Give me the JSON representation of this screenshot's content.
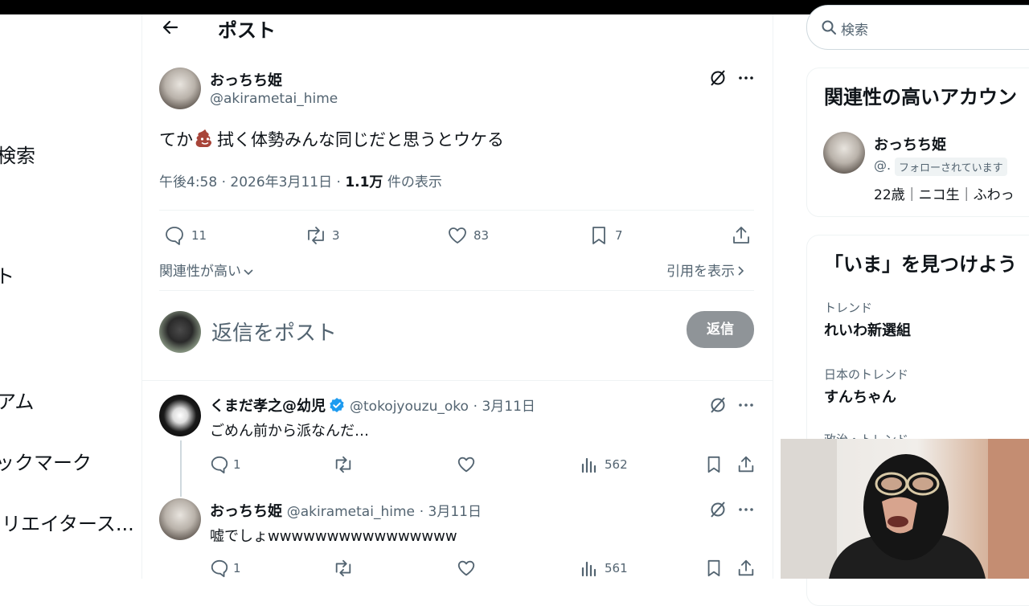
{
  "nav": {
    "items": [
      "検索",
      "ト",
      "アム",
      "ブックマーク",
      "クリエイタース..."
    ]
  },
  "header": {
    "title": "ポスト"
  },
  "post": {
    "author_name": "おっちち姫",
    "author_handle": "@akirametai_hime",
    "text_before": "てか",
    "text_after": "拭く体勢みんな同じだと思うとウケる",
    "meta_time": "午後4:58 · 2026年3月11日 · ",
    "views_count": "1.1万",
    "views_label": " 件の表示",
    "replies": "11",
    "reposts": "3",
    "likes": "83",
    "bookmarks": "7",
    "sort_label": "関連性が高い",
    "quotes_label": "引用を表示"
  },
  "composer": {
    "placeholder": "返信をポスト",
    "button": "返信"
  },
  "replies": [
    {
      "name": "くまだ孝之@幼児",
      "handle": "@tokojyouzu_oko",
      "date": "· 3月11日",
      "text": "ごめん前から派なんだ…",
      "reply_count": "1",
      "views": "562"
    },
    {
      "name": "おっちち姫",
      "handle": "@akirametai_hime",
      "date": "· 3月11日",
      "text": "嘘でしょwwwwwwwwwwwwwwww",
      "reply_count": "1",
      "views": "561"
    }
  ],
  "search": {
    "placeholder": "検索"
  },
  "related": {
    "title": "関連性の高いアカウン",
    "name": "おっちち姫",
    "handle": "@.",
    "follows_badge": "フォローされています",
    "bio": "22歳｜ニコ生｜ふわっ"
  },
  "trends": {
    "title": "「いま」を見つけよう",
    "items": [
      {
        "label": "トレンド",
        "name": "れいわ新選組"
      },
      {
        "label": "日本のトレンド",
        "name": "すんちゃん"
      },
      {
        "label": "政治・トレンド",
        "name": ""
      }
    ]
  },
  "colors": {
    "text": "#0f1419",
    "muted": "#536471",
    "verified": "#1d9bf0",
    "button_disabled": "#8f9498",
    "border": "#eff3f4"
  }
}
